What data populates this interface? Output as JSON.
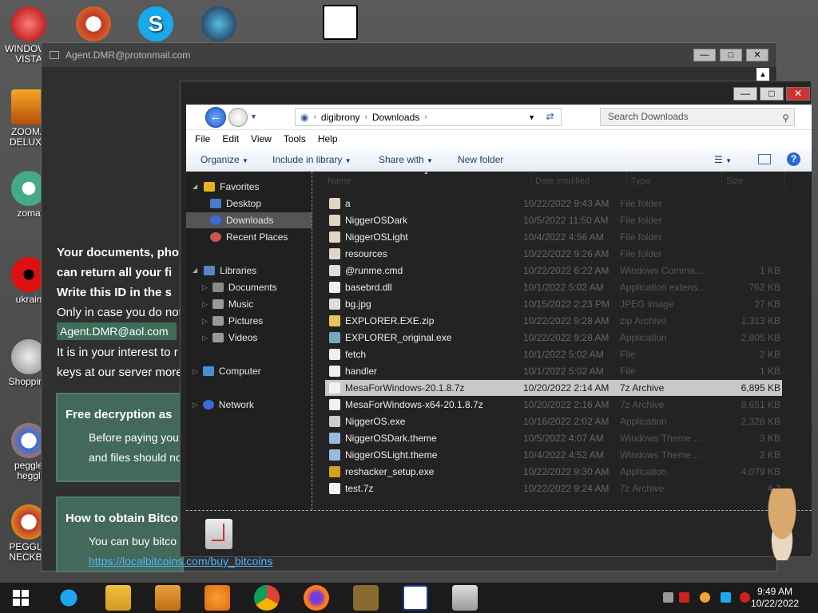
{
  "desktop": {
    "icons": [
      {
        "label": "WINDOWS VISTA",
        "id": "windows-vista"
      },
      {
        "label": "ZOOMA DELUXE",
        "id": "zooma-deluxe"
      },
      {
        "label": "zoma",
        "id": "zoma"
      },
      {
        "label": "ukrain",
        "id": "ukrain"
      },
      {
        "label": "Shopping",
        "id": "shopping"
      },
      {
        "label": "peggle heggl",
        "id": "peggle"
      },
      {
        "label": "PEGGLE NECKBE",
        "id": "peggle-nb"
      }
    ]
  },
  "ransom": {
    "title": "Agent.DMR@protonmail.com",
    "line1": "Your documents, pho",
    "line2": "can return all your fi",
    "line3": "Write this ID in the s",
    "line4": "Only in case you do not",
    "email": "Agent.DMR@aol.com",
    "line5": "It is in your interest to r",
    "line6": "keys at our server more",
    "box1_title": "Free decryption as",
    "box1_l1": "Before paying you",
    "box1_l2": "and files should no",
    "box2_title": "How to obtain Bitco",
    "box2_l1": "You can buy bitco",
    "box2_link": "https://localbitcoins.com/buy_bitcoins"
  },
  "explorer": {
    "breadcrumb": [
      "digibrony",
      "Downloads"
    ],
    "search_placeholder": "Search Downloads",
    "menu": [
      "File",
      "Edit",
      "View",
      "Tools",
      "Help"
    ],
    "toolbar": {
      "organize": "Organize",
      "include": "Include in library",
      "share": "Share with",
      "newfolder": "New folder"
    },
    "columns": [
      "Name",
      "Date modified",
      "Type",
      "Size"
    ],
    "nav": {
      "favorites": "Favorites",
      "desktop": "Desktop",
      "downloads": "Downloads",
      "recent": "Recent Places",
      "libraries": "Libraries",
      "documents": "Documents",
      "music": "Music",
      "pictures": "Pictures",
      "videos": "Videos",
      "computer": "Computer",
      "network": "Network"
    },
    "files": [
      {
        "name": "a",
        "date": "10/22/2022 9:43 AM",
        "type": "File folder",
        "size": "",
        "icon": "folder"
      },
      {
        "name": "NiggerOSDark",
        "date": "10/5/2022 11:50 AM",
        "type": "File folder",
        "size": "",
        "icon": "folder"
      },
      {
        "name": "NiggerOSLight",
        "date": "10/4/2022 4:56 AM",
        "type": "File folder",
        "size": "",
        "icon": "folder"
      },
      {
        "name": "resources",
        "date": "10/22/2022 9:26 AM",
        "type": "File folder",
        "size": "",
        "icon": "folder"
      },
      {
        "name": "@runme.cmd",
        "date": "10/22/2022 6:22 AM",
        "type": "Windows Comma...",
        "size": "1 KB",
        "icon": "cmd"
      },
      {
        "name": "basebrd.dll",
        "date": "10/1/2022 5:02 AM",
        "type": "Application extens...",
        "size": "762 KB",
        "icon": "dll"
      },
      {
        "name": "bg.jpg",
        "date": "10/15/2022 2:23 PM",
        "type": "JPEG image",
        "size": "27 KB",
        "icon": "jpg"
      },
      {
        "name": "EXPLORER.EXE.zip",
        "date": "10/22/2022 9:28 AM",
        "type": "zip Archive",
        "size": "1,313 KB",
        "icon": "zip"
      },
      {
        "name": "EXPLORER_original.exe",
        "date": "10/22/2022 9:28 AM",
        "type": "Application",
        "size": "2,805 KB",
        "icon": "exe"
      },
      {
        "name": "fetch",
        "date": "10/1/2022 5:02 AM",
        "type": "File",
        "size": "2 KB",
        "icon": "file"
      },
      {
        "name": "handler",
        "date": "10/1/2022 5:02 AM",
        "type": "File",
        "size": "1 KB",
        "icon": "file"
      },
      {
        "name": "MesaForWindows-20.1.8.7z",
        "date": "10/20/2022 2:14 AM",
        "type": "7z Archive",
        "size": "6,895 KB",
        "icon": "7z"
      },
      {
        "name": "MesaForWindows-x64-20.1.8.7z",
        "date": "10/20/2022 2:16 AM",
        "type": "7z Archive",
        "size": "8,651 KB",
        "icon": "7z"
      },
      {
        "name": "NiggerOS.exe",
        "date": "10/16/2022 2:02 AM",
        "type": "Application",
        "size": "2,328 KB",
        "icon": "exe2"
      },
      {
        "name": "NiggerOSDark.theme",
        "date": "10/5/2022 4:07 AM",
        "type": "Windows Theme ...",
        "size": "3 KB",
        "icon": "theme"
      },
      {
        "name": "NiggerOSLight.theme",
        "date": "10/4/2022 4:52 AM",
        "type": "Windows Theme ...",
        "size": "2 KB",
        "icon": "theme"
      },
      {
        "name": "reshacker_setup.exe",
        "date": "10/22/2022 9:30 AM",
        "type": "Application",
        "size": "4,079 KB",
        "icon": "rh"
      },
      {
        "name": "test.7z",
        "date": "10/22/2022 9:24 AM",
        "type": "7z Archive",
        "size": "4,2",
        "icon": "7z"
      }
    ]
  },
  "taskbar": {
    "time": "9:49 AM",
    "date": "10/22/2022"
  },
  "colors": {
    "folder": "#d9c79a",
    "accent": "#1f5bc9",
    "green": "#43695a"
  }
}
